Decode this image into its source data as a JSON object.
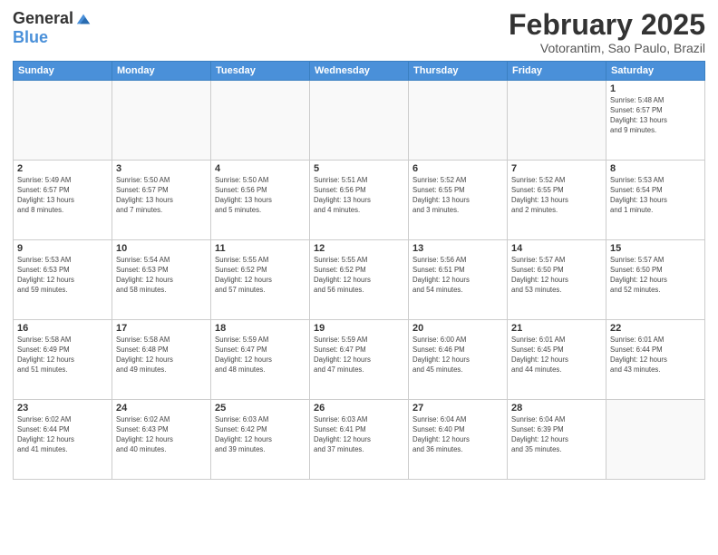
{
  "header": {
    "logo_general": "General",
    "logo_blue": "Blue",
    "month_title": "February 2025",
    "location": "Votorantim, Sao Paulo, Brazil"
  },
  "days_of_week": [
    "Sunday",
    "Monday",
    "Tuesday",
    "Wednesday",
    "Thursday",
    "Friday",
    "Saturday"
  ],
  "weeks": [
    [
      {
        "day": "",
        "info": ""
      },
      {
        "day": "",
        "info": ""
      },
      {
        "day": "",
        "info": ""
      },
      {
        "day": "",
        "info": ""
      },
      {
        "day": "",
        "info": ""
      },
      {
        "day": "",
        "info": ""
      },
      {
        "day": "1",
        "info": "Sunrise: 5:48 AM\nSunset: 6:57 PM\nDaylight: 13 hours\nand 9 minutes."
      }
    ],
    [
      {
        "day": "2",
        "info": "Sunrise: 5:49 AM\nSunset: 6:57 PM\nDaylight: 13 hours\nand 8 minutes."
      },
      {
        "day": "3",
        "info": "Sunrise: 5:50 AM\nSunset: 6:57 PM\nDaylight: 13 hours\nand 7 minutes."
      },
      {
        "day": "4",
        "info": "Sunrise: 5:50 AM\nSunset: 6:56 PM\nDaylight: 13 hours\nand 5 minutes."
      },
      {
        "day": "5",
        "info": "Sunrise: 5:51 AM\nSunset: 6:56 PM\nDaylight: 13 hours\nand 4 minutes."
      },
      {
        "day": "6",
        "info": "Sunrise: 5:52 AM\nSunset: 6:55 PM\nDaylight: 13 hours\nand 3 minutes."
      },
      {
        "day": "7",
        "info": "Sunrise: 5:52 AM\nSunset: 6:55 PM\nDaylight: 13 hours\nand 2 minutes."
      },
      {
        "day": "8",
        "info": "Sunrise: 5:53 AM\nSunset: 6:54 PM\nDaylight: 13 hours\nand 1 minute."
      }
    ],
    [
      {
        "day": "9",
        "info": "Sunrise: 5:53 AM\nSunset: 6:53 PM\nDaylight: 12 hours\nand 59 minutes."
      },
      {
        "day": "10",
        "info": "Sunrise: 5:54 AM\nSunset: 6:53 PM\nDaylight: 12 hours\nand 58 minutes."
      },
      {
        "day": "11",
        "info": "Sunrise: 5:55 AM\nSunset: 6:52 PM\nDaylight: 12 hours\nand 57 minutes."
      },
      {
        "day": "12",
        "info": "Sunrise: 5:55 AM\nSunset: 6:52 PM\nDaylight: 12 hours\nand 56 minutes."
      },
      {
        "day": "13",
        "info": "Sunrise: 5:56 AM\nSunset: 6:51 PM\nDaylight: 12 hours\nand 54 minutes."
      },
      {
        "day": "14",
        "info": "Sunrise: 5:57 AM\nSunset: 6:50 PM\nDaylight: 12 hours\nand 53 minutes."
      },
      {
        "day": "15",
        "info": "Sunrise: 5:57 AM\nSunset: 6:50 PM\nDaylight: 12 hours\nand 52 minutes."
      }
    ],
    [
      {
        "day": "16",
        "info": "Sunrise: 5:58 AM\nSunset: 6:49 PM\nDaylight: 12 hours\nand 51 minutes."
      },
      {
        "day": "17",
        "info": "Sunrise: 5:58 AM\nSunset: 6:48 PM\nDaylight: 12 hours\nand 49 minutes."
      },
      {
        "day": "18",
        "info": "Sunrise: 5:59 AM\nSunset: 6:47 PM\nDaylight: 12 hours\nand 48 minutes."
      },
      {
        "day": "19",
        "info": "Sunrise: 5:59 AM\nSunset: 6:47 PM\nDaylight: 12 hours\nand 47 minutes."
      },
      {
        "day": "20",
        "info": "Sunrise: 6:00 AM\nSunset: 6:46 PM\nDaylight: 12 hours\nand 45 minutes."
      },
      {
        "day": "21",
        "info": "Sunrise: 6:01 AM\nSunset: 6:45 PM\nDaylight: 12 hours\nand 44 minutes."
      },
      {
        "day": "22",
        "info": "Sunrise: 6:01 AM\nSunset: 6:44 PM\nDaylight: 12 hours\nand 43 minutes."
      }
    ],
    [
      {
        "day": "23",
        "info": "Sunrise: 6:02 AM\nSunset: 6:44 PM\nDaylight: 12 hours\nand 41 minutes."
      },
      {
        "day": "24",
        "info": "Sunrise: 6:02 AM\nSunset: 6:43 PM\nDaylight: 12 hours\nand 40 minutes."
      },
      {
        "day": "25",
        "info": "Sunrise: 6:03 AM\nSunset: 6:42 PM\nDaylight: 12 hours\nand 39 minutes."
      },
      {
        "day": "26",
        "info": "Sunrise: 6:03 AM\nSunset: 6:41 PM\nDaylight: 12 hours\nand 37 minutes."
      },
      {
        "day": "27",
        "info": "Sunrise: 6:04 AM\nSunset: 6:40 PM\nDaylight: 12 hours\nand 36 minutes."
      },
      {
        "day": "28",
        "info": "Sunrise: 6:04 AM\nSunset: 6:39 PM\nDaylight: 12 hours\nand 35 minutes."
      },
      {
        "day": "",
        "info": ""
      }
    ]
  ]
}
